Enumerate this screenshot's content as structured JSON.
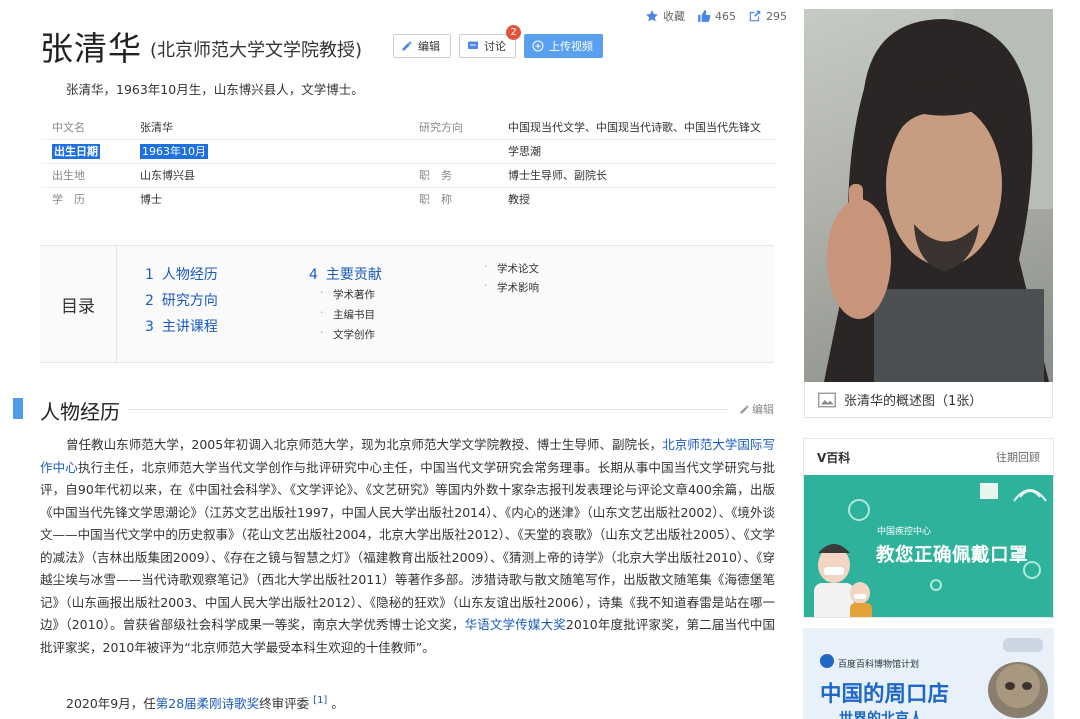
{
  "stats": {
    "favorite_label": "收藏",
    "likes": "465",
    "shares": "295"
  },
  "header": {
    "title": "张清华",
    "subtitle": "(北京师范大学文学院教授)",
    "edit_label": "编辑",
    "discuss_label": "讨论",
    "discuss_badge": "2",
    "upload_label": "上传视频"
  },
  "intro": "张清华，1963年10月生，山东博兴县人，文学博士。",
  "info": {
    "left": [
      {
        "key": "中文名",
        "value": "张清华"
      },
      {
        "key": "出生日期",
        "value": "1963年10月"
      },
      {
        "key": "出生地",
        "value": "山东博兴县"
      },
      {
        "key": "学　历",
        "value": "博士"
      }
    ],
    "right": [
      {
        "key": "研究方向",
        "value": "中国现当代文学、中国现当代诗歌、中国当代先锋文"
      },
      {
        "key": "",
        "value": "学思潮"
      },
      {
        "key": "职　务",
        "value": "博士生导师、副院长"
      },
      {
        "key": "职　称",
        "value": "教授"
      }
    ]
  },
  "catalog": {
    "label": "目录",
    "items": [
      {
        "num": "1",
        "label": "人物经历"
      },
      {
        "num": "2",
        "label": "研究方向"
      },
      {
        "num": "3",
        "label": "主讲课程"
      },
      {
        "num": "4",
        "label": "主要贡献"
      }
    ],
    "sub4": [
      "学术著作",
      "主编书目",
      "文学创作"
    ],
    "sub4b": [
      "学术论文",
      "学术影响"
    ]
  },
  "section": {
    "title": "人物经历",
    "edit_label": "编辑"
  },
  "para1": {
    "t1": "曾任教山东师范大学，2005年初调入北京师范大学，现为北京师范大学文学院教授、博士生导师、副院长，",
    "link1": "北京师范大学国际写作中心",
    "t2": "执行主任，北京师范大学当代文学创作与批评研究中心主任，中国当代文学研究会常务理事。长期从事中国当代文学研究与批评，自90年代初以来，在《中国社会科学》、《文学评论》、《文艺研究》等国内外数十家杂志报刊发表理论与评论文章400余篇，出版《中国当代先锋文学思潮论》（江苏文艺出版社1997，中国人民大学出版社2014）、《内心的迷津》（山东文艺出版社2002）、《境外谈文——中国当代文学中的历史叙事》（花山文艺出版社2004，北京大学出版社2012）、《天堂的哀歌》（山东文艺出版社2005）、《文学的减法》（吉林出版集团2009）、《存在之镜与智慧之灯》（福建教育出版社2009）、《猜测上帝的诗学》（北京大学出版社2010）、《穿越尘埃与冰雪——当代诗歌观察笔记》（西北大学出版社2011）等著作多部。涉猎诗歌与散文随笔写作，出版散文随笔集《海德堡笔记》（山东画报出版社2003、中国人民大学出版社2012）、《隐秘的狂欢》（山东友谊出版社2006），诗集《我不知道春雷是站在哪一边》（2010）。曾获省部级社会科学成果一等奖，南京大学优秀博士论文奖，",
    "link2": "华语文学传媒大奖",
    "t3": "2010年度批评家奖，第二届当代中国批评家奖，2010年被评为“北京师范大学最受本科生欢迎的十佳教师”。"
  },
  "para2": {
    "t1": "2020年9月，任",
    "link": "第28届柔刚诗歌奖",
    "t2": "终审评委",
    "ref": "[1]",
    "t3": "。"
  },
  "sidebar": {
    "photo_caption": "张清华的概述图（1张）",
    "vbox_title": "V百科",
    "vbox_link": "往期回顾",
    "banner1_small": "中国疾控中心",
    "banner1_big": "教您正确佩戴口罩",
    "banner2_small": "百度百科博物馆计划",
    "banner2_big": "中国的周口店",
    "banner2_sub": "世界的北京人"
  },
  "colors": {
    "link": "#1a5bbd",
    "accent": "#4f9cee",
    "selection": "#1e6fe0",
    "banner_green": "#2fb29b"
  }
}
